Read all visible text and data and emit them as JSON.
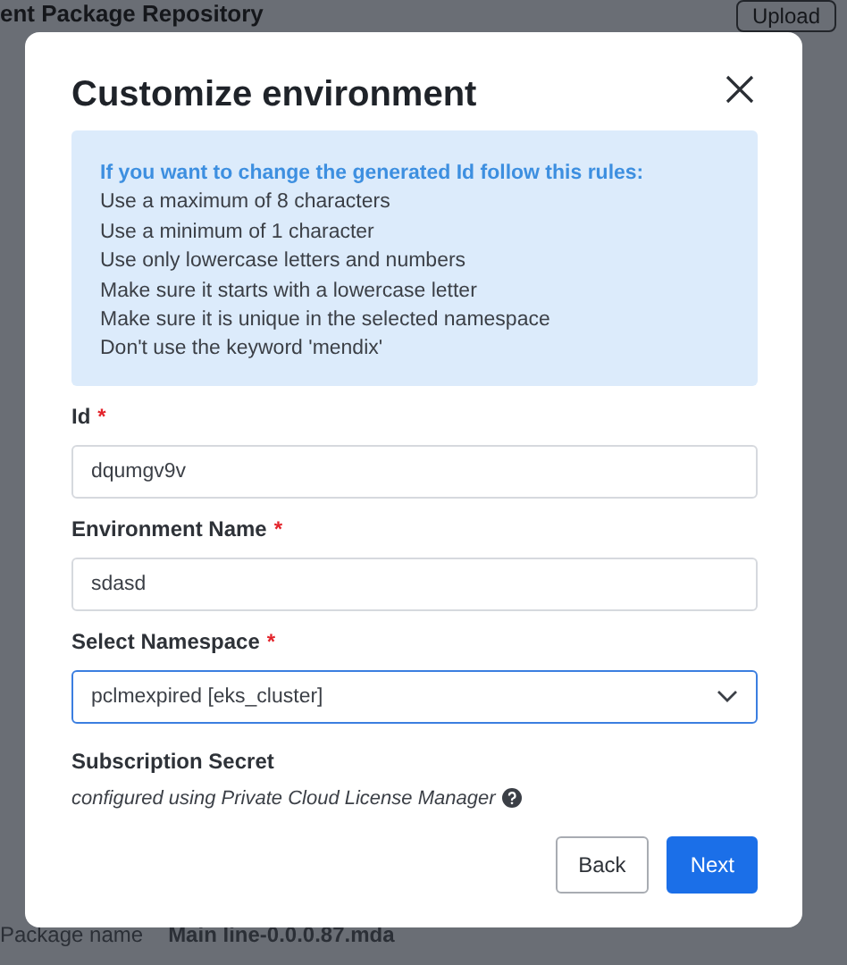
{
  "background_page": {
    "heading": "ent Package Repository",
    "upload_button": "Upload",
    "package_label": "Package name",
    "package_value": "Main line-0.0.0.87.mda"
  },
  "dialog": {
    "title": "Customize environment",
    "info": {
      "heading": "If you want to change the generated Id follow this rules:",
      "rules": [
        "Use a maximum of 8 characters",
        "Use a minimum of 1 character",
        "Use only lowercase letters and numbers",
        "Make sure it starts with a lowercase letter",
        "Make sure it is unique in the selected namespace",
        "Don't use the keyword 'mendix'"
      ]
    },
    "required_mark": "*",
    "fields": [
      {
        "kind": "text",
        "label": "Id",
        "required": true,
        "value": "dqumgv9v",
        "focused": false
      },
      {
        "kind": "text",
        "label": "Environment Name",
        "required": true,
        "value": "sdasd",
        "focused": false
      },
      {
        "kind": "select",
        "label": "Select Namespace",
        "required": true,
        "value": "pclmexpired [eks_cluster]",
        "focused": true
      }
    ],
    "subscription": {
      "label": "Subscription Secret",
      "note": "configured using Private Cloud License Manager"
    },
    "buttons": [
      {
        "label": "Back",
        "primary": false
      },
      {
        "label": "Next",
        "primary": true
      }
    ]
  }
}
